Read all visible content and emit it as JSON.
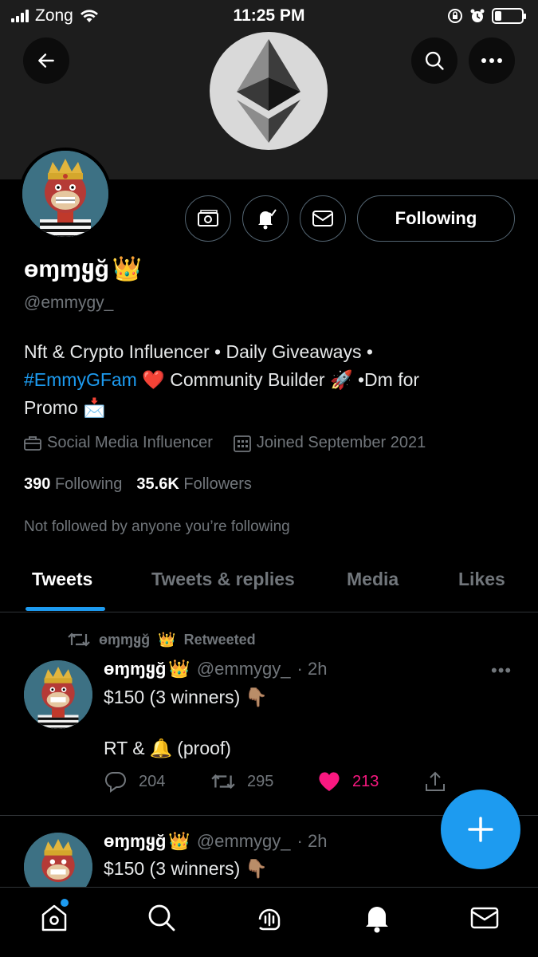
{
  "status_bar": {
    "carrier": "Zong",
    "time": "11:25 PM",
    "battery_level": 0.25
  },
  "header": {
    "back_icon": "arrow-left-icon",
    "search_icon": "search-icon",
    "more_icon": "more-horizontal-icon",
    "banner_logo": "ethereum-logo"
  },
  "profile": {
    "display_name": "ɵɱɱყğ",
    "name_emoji": "👑",
    "handle": "@emmygy_",
    "bio_line1": "Nft & Crypto Influencer • Daily Giveaways •",
    "bio_tag": "#EmmyGFam",
    "bio_line2_rest": "Community Builder",
    "bio_line2_end": "•Dm for",
    "bio_line3": "Promo",
    "heart_emoji": "❤️",
    "rocket_emoji": "🚀",
    "envelope_emoji": "📩",
    "category": "Social Media Influencer",
    "joined": "Joined September 2021",
    "following_count": "390",
    "following_label": "Following",
    "followers_count": "35.6K",
    "followers_label": "Followers",
    "not_followed_text": "Not followed by anyone you’re following",
    "following_button": "Following",
    "action_icons": [
      "money-icon",
      "notification-bell-icon",
      "mail-icon"
    ]
  },
  "tabs": [
    {
      "label": "Tweets",
      "active": true
    },
    {
      "label": "Tweets & replies",
      "active": false
    },
    {
      "label": "Media",
      "active": false
    },
    {
      "label": "Likes",
      "active": false
    }
  ],
  "tweets": [
    {
      "retweeted_by": "ɵɱɱყğ",
      "retweet_label": "Retweeted",
      "name": "ɵɱɱყğ",
      "handle": "@emmygy_",
      "time": "· 2h",
      "text_line1": "$150 (3 winners)",
      "text_line1_emoji": "👇🏽",
      "text_line2_a": "RT &",
      "text_line2_emoji": "🔔",
      "text_line2_b": "(proof)",
      "replies": "204",
      "retweets": "295",
      "likes": "213",
      "liked": true
    },
    {
      "name": "ɵɱɱყğ",
      "handle": "@emmygy_",
      "time": "· 2h",
      "text_line1": "$150 (3 winners)",
      "text_line1_emoji": "👇🏽"
    }
  ],
  "fab": {
    "icon": "plus-icon"
  },
  "bottom_nav": [
    "home-icon",
    "search-icon",
    "spaces-icon",
    "notifications-icon",
    "messages-icon"
  ],
  "colors": {
    "accent": "#1d9bf0",
    "like": "#f91880",
    "muted": "#71767b",
    "background": "#000000"
  }
}
